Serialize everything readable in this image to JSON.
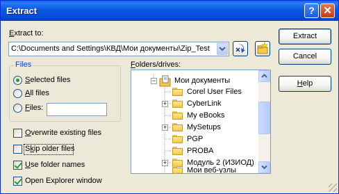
{
  "window": {
    "title": "Extract"
  },
  "titlebar": {
    "help_glyph": "?",
    "close_glyph": "✕"
  },
  "extract_to": {
    "label": "Extract to:",
    "path": "C:\\Documents and Settings\\КВД\\Мои документы\\Zip_Test"
  },
  "buttons": {
    "extract": "Extract",
    "cancel": "Cancel",
    "help": "Help"
  },
  "files_group": {
    "title": "Files",
    "options": [
      {
        "label": "Selected files",
        "selected": true
      },
      {
        "label": "All files",
        "selected": false
      },
      {
        "label": "Files:",
        "selected": false
      }
    ],
    "files_value": ""
  },
  "checkboxes": [
    {
      "label": "Overwrite existing files",
      "checked": false
    },
    {
      "label": "Skip older files",
      "checked": false
    },
    {
      "label": "Use folder names",
      "checked": true
    },
    {
      "label": "Open Explorer window",
      "checked": true
    }
  ],
  "folders": {
    "label": "Folders/drives:",
    "root": "Мои документы",
    "items": [
      {
        "name": "Corel User Files",
        "expandable": false
      },
      {
        "name": "CyberLink",
        "expandable": true
      },
      {
        "name": "My eBooks",
        "expandable": false
      },
      {
        "name": "MySetups",
        "expandable": true
      },
      {
        "name": "PGP",
        "expandable": false
      },
      {
        "name": "PROBA",
        "expandable": false
      },
      {
        "name": "Модуль 2 (ИЗИОД)",
        "expandable": true
      },
      {
        "name": "Мои веб-узлы",
        "expandable": false
      }
    ]
  },
  "colors": {
    "titlebar": "#0a5ae0",
    "dialog_bg": "#ece9d8",
    "group_title": "#0046d5"
  }
}
